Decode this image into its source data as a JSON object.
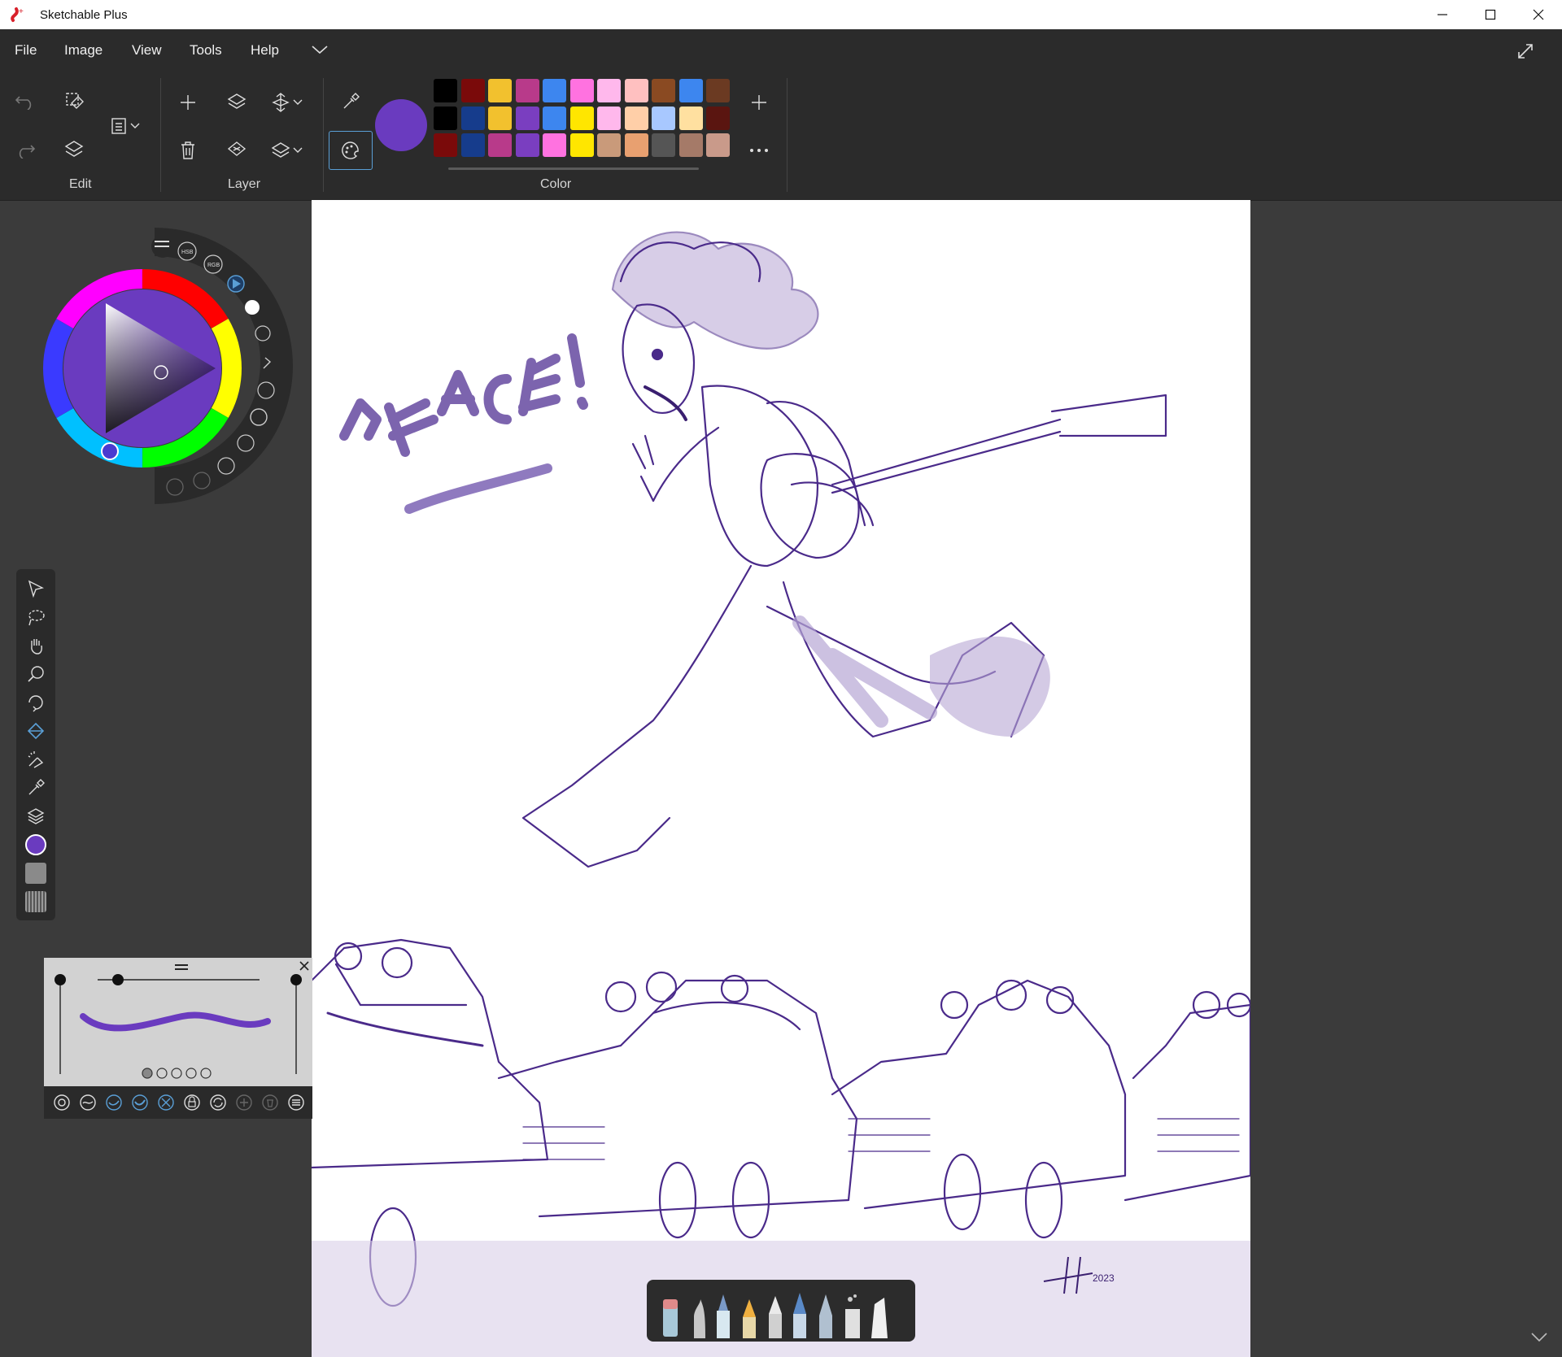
{
  "window": {
    "title": "Sketchable Plus"
  },
  "menu": {
    "items": [
      "File",
      "Image",
      "View",
      "Tools",
      "Help"
    ]
  },
  "ribbon": {
    "groups": {
      "edit": "Edit",
      "layer": "Layer",
      "color": "Color"
    },
    "current_color": "#6a3bbf",
    "palette": [
      [
        "#000000",
        "#7a0a0a",
        "#f2c12e",
        "#b83a8a",
        "#3d86ef",
        "#ff72e0",
        "#ffb8ec",
        "#ffc0c0",
        "#8a4a22",
        "#3d86ef",
        "#6b3a22"
      ],
      [
        "#000000",
        "#163c8c",
        "#f2c12e",
        "#7a3ec0",
        "#3d86ef",
        "#ffe600",
        "#ffb8ec",
        "#ffcfa8",
        "#a8c8ff",
        "#ffe0a0",
        "#5a1510"
      ],
      [
        "#7a0a0a",
        "#163c8c",
        "#b83a8a",
        "#7a3ec0",
        "#ff72e0",
        "#ffe600",
        "#c99a7a",
        "#e8a070",
        "#555555",
        "#a57a68",
        "#c99a8a"
      ]
    ]
  },
  "color_puck": {
    "modes": [
      "HSB",
      "RGB"
    ],
    "selected_hue": "#6a3bbf"
  },
  "toolbar": {
    "tools": [
      "select-tool-icon",
      "lasso-tool-icon",
      "pan-tool-icon",
      "zoom-tool-icon",
      "rotate-tool-icon",
      "fill-tool-icon",
      "magic-wand-icon",
      "eyedropper-icon",
      "layers-icon",
      "color-swatch",
      "texture-swatch",
      "pattern-swatch"
    ]
  },
  "canvas": {
    "drawing_text": "PEACE!",
    "signature": "2023"
  },
  "brush_panel": {
    "stroke_color": "#6a3bbf"
  }
}
